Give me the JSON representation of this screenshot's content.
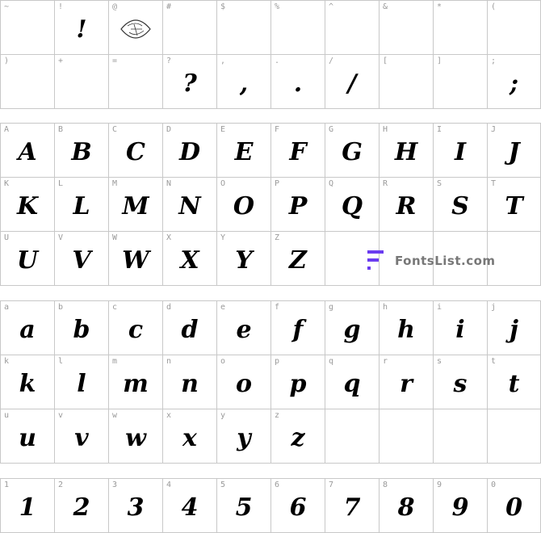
{
  "sections": [
    {
      "name": "punctuation",
      "rows": [
        [
          {
            "label": "~",
            "glyph": ""
          },
          {
            "label": "!",
            "glyph": "!"
          },
          {
            "label": "@",
            "glyph": ""
          },
          {
            "label": "#",
            "glyph": ""
          },
          {
            "label": "$",
            "glyph": ""
          },
          {
            "label": "%",
            "glyph": ""
          },
          {
            "label": "^",
            "glyph": ""
          },
          {
            "label": "&",
            "glyph": ""
          },
          {
            "label": "*",
            "glyph": ""
          },
          {
            "label": "(",
            "glyph": ""
          }
        ],
        [
          {
            "label": ")",
            "glyph": ""
          },
          {
            "label": "+",
            "glyph": ""
          },
          {
            "label": "=",
            "glyph": ""
          },
          {
            "label": "?",
            "glyph": "?"
          },
          {
            "label": ",",
            "glyph": ","
          },
          {
            "label": ".",
            "glyph": "."
          },
          {
            "label": "/",
            "glyph": "/"
          },
          {
            "label": "[",
            "glyph": ""
          },
          {
            "label": "]",
            "glyph": ""
          },
          {
            "label": ";",
            "glyph": ";"
          }
        ]
      ]
    },
    {
      "name": "uppercase",
      "rows": [
        [
          {
            "label": "A",
            "glyph": "A"
          },
          {
            "label": "B",
            "glyph": "B"
          },
          {
            "label": "C",
            "glyph": "C"
          },
          {
            "label": "D",
            "glyph": "D"
          },
          {
            "label": "E",
            "glyph": "E"
          },
          {
            "label": "F",
            "glyph": "F"
          },
          {
            "label": "G",
            "glyph": "G"
          },
          {
            "label": "H",
            "glyph": "H"
          },
          {
            "label": "I",
            "glyph": "I"
          },
          {
            "label": "J",
            "glyph": "J"
          }
        ],
        [
          {
            "label": "K",
            "glyph": "K"
          },
          {
            "label": "L",
            "glyph": "L"
          },
          {
            "label": "M",
            "glyph": "M"
          },
          {
            "label": "N",
            "glyph": "N"
          },
          {
            "label": "O",
            "glyph": "O"
          },
          {
            "label": "P",
            "glyph": "P"
          },
          {
            "label": "Q",
            "glyph": "Q"
          },
          {
            "label": "R",
            "glyph": "R"
          },
          {
            "label": "S",
            "glyph": "S"
          },
          {
            "label": "T",
            "glyph": "T"
          }
        ],
        [
          {
            "label": "U",
            "glyph": "U"
          },
          {
            "label": "V",
            "glyph": "V"
          },
          {
            "label": "W",
            "glyph": "W"
          },
          {
            "label": "X",
            "glyph": "X"
          },
          {
            "label": "Y",
            "glyph": "Y"
          },
          {
            "label": "Z",
            "glyph": "Z"
          },
          {
            "label": "",
            "glyph": ""
          },
          {
            "label": "",
            "glyph": ""
          },
          {
            "label": "",
            "glyph": ""
          },
          {
            "label": "",
            "glyph": ""
          }
        ]
      ]
    },
    {
      "name": "lowercase",
      "rows": [
        [
          {
            "label": "a",
            "glyph": "a"
          },
          {
            "label": "b",
            "glyph": "b"
          },
          {
            "label": "c",
            "glyph": "c"
          },
          {
            "label": "d",
            "glyph": "d"
          },
          {
            "label": "e",
            "glyph": "e"
          },
          {
            "label": "f",
            "glyph": "f"
          },
          {
            "label": "g",
            "glyph": "g"
          },
          {
            "label": "h",
            "glyph": "h"
          },
          {
            "label": "i",
            "glyph": "i"
          },
          {
            "label": "j",
            "glyph": "j"
          }
        ],
        [
          {
            "label": "k",
            "glyph": "k"
          },
          {
            "label": "l",
            "glyph": "l"
          },
          {
            "label": "m",
            "glyph": "m"
          },
          {
            "label": "n",
            "glyph": "n"
          },
          {
            "label": "o",
            "glyph": "o"
          },
          {
            "label": "p",
            "glyph": "p"
          },
          {
            "label": "q",
            "glyph": "q"
          },
          {
            "label": "r",
            "glyph": "r"
          },
          {
            "label": "s",
            "glyph": "s"
          },
          {
            "label": "t",
            "glyph": "t"
          }
        ],
        [
          {
            "label": "u",
            "glyph": "u"
          },
          {
            "label": "v",
            "glyph": "v"
          },
          {
            "label": "w",
            "glyph": "w"
          },
          {
            "label": "x",
            "glyph": "x"
          },
          {
            "label": "y",
            "glyph": "y"
          },
          {
            "label": "z",
            "glyph": "z"
          },
          {
            "label": "",
            "glyph": ""
          },
          {
            "label": "",
            "glyph": ""
          },
          {
            "label": "",
            "glyph": ""
          },
          {
            "label": "",
            "glyph": ""
          }
        ]
      ]
    },
    {
      "name": "digits",
      "rows": [
        [
          {
            "label": "1",
            "glyph": "1"
          },
          {
            "label": "2",
            "glyph": "2"
          },
          {
            "label": "3",
            "glyph": "3"
          },
          {
            "label": "4",
            "glyph": "4"
          },
          {
            "label": "5",
            "glyph": "5"
          },
          {
            "label": "6",
            "glyph": "6"
          },
          {
            "label": "7",
            "glyph": "7"
          },
          {
            "label": "8",
            "glyph": "8"
          },
          {
            "label": "9",
            "glyph": "9"
          },
          {
            "label": "0",
            "glyph": "0"
          }
        ]
      ]
    }
  ],
  "watermark": {
    "text": "FontsList.com",
    "color": "#6a3cf0"
  },
  "icons": {
    "at_cell": "ornament-seal-icon"
  }
}
